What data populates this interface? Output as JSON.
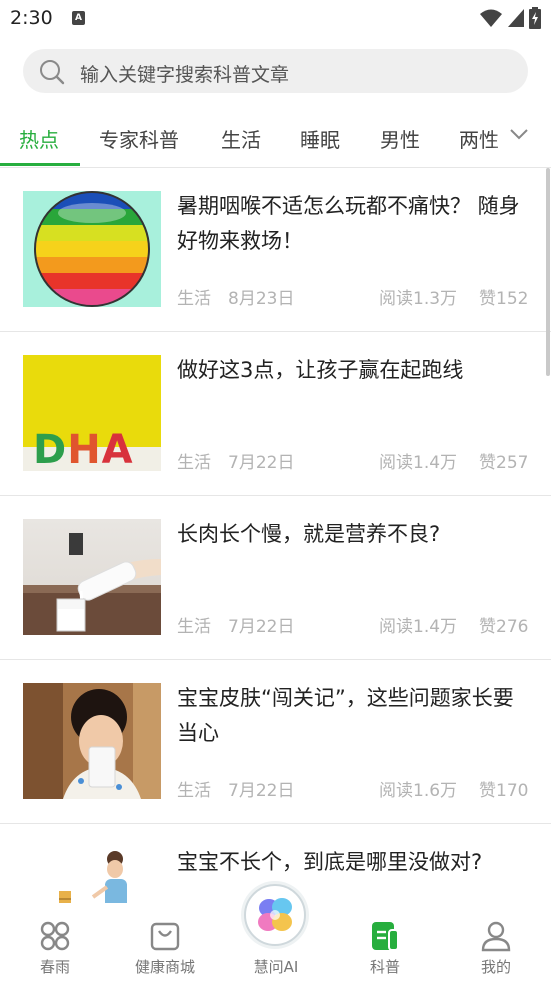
{
  "status_bar": {
    "time": "2:30",
    "notification_glyph": "A"
  },
  "search": {
    "placeholder": "输入关键字搜索科普文章"
  },
  "tabs": [
    {
      "label": "热点",
      "active": true
    },
    {
      "label": "专家科普"
    },
    {
      "label": "生活"
    },
    {
      "label": "睡眠"
    },
    {
      "label": "男性"
    },
    {
      "label": "两性"
    }
  ],
  "articles": [
    {
      "title": "暑期咽喉不适怎么玩都不痛快？ 随身好物来救场！",
      "category": "生活",
      "date": "8月23日",
      "reads": "阅读1.3万",
      "likes": "赞152",
      "thumb": "rainbow-ball-image"
    },
    {
      "title": "做好这3点，让孩子赢在起跑线",
      "category": "生活",
      "date": "7月22日",
      "reads": "阅读1.4万",
      "likes": "赞257",
      "thumb": "dha-letters-image",
      "thumb_text": "DHA"
    },
    {
      "title": "长肉长个慢，就是营养不良?",
      "category": "生活",
      "date": "7月22日",
      "reads": "阅读1.4万",
      "likes": "赞276",
      "thumb": "pouring-milk-image"
    },
    {
      "title": "宝宝皮肤“闯关记”，这些问题家长要当心",
      "category": "生活",
      "date": "7月22日",
      "reads": "阅读1.6万",
      "likes": "赞170",
      "thumb": "girl-drinking-milk-image"
    },
    {
      "title": "宝宝不长个，到底是哪里没做对?",
      "thumb": "child-height-chart-image"
    }
  ],
  "bottom_nav": [
    {
      "label": "春雨",
      "icon": "grid-icon"
    },
    {
      "label": "健康商城",
      "icon": "shopping-bag-icon"
    },
    {
      "label": "慧问AI",
      "icon": "ai-flower-icon"
    },
    {
      "label": "科普",
      "icon": "document-icon",
      "active": true
    },
    {
      "label": "我的",
      "icon": "person-icon"
    }
  ],
  "colors": {
    "accent": "#27ae3e",
    "meta_text": "#b3b3b3",
    "search_bg": "#efefef"
  }
}
